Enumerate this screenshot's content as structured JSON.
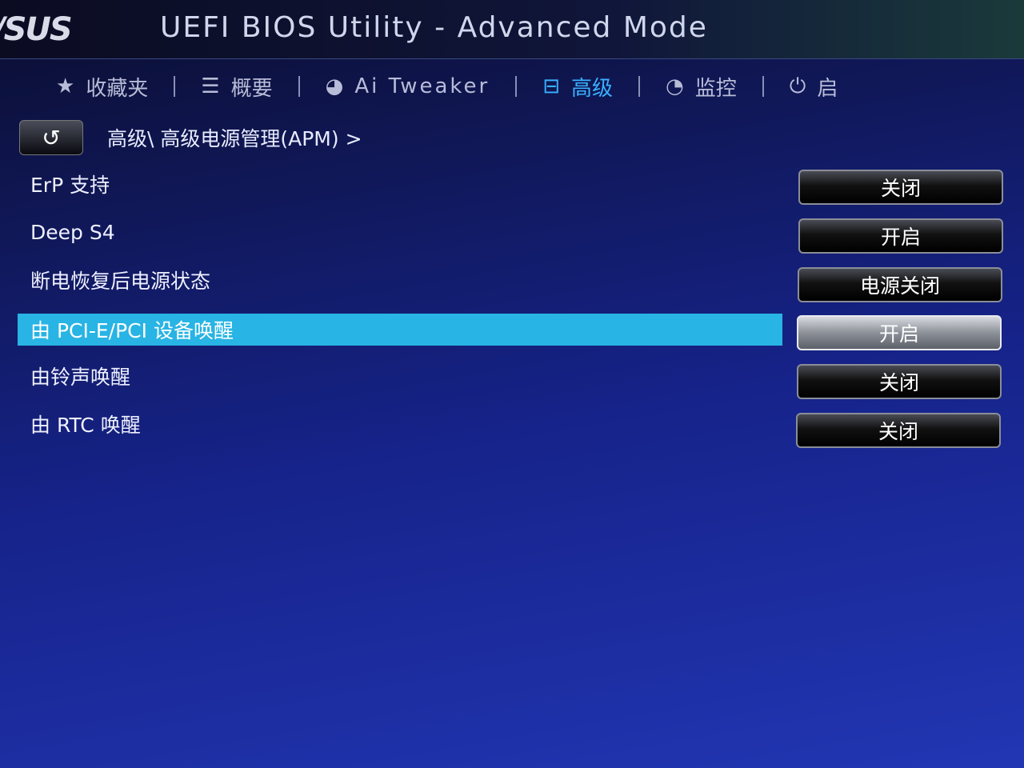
{
  "header": {
    "logo": "/SUS",
    "title": "UEFI BIOS Utility - Advanced Mode"
  },
  "tabs": [
    {
      "label": "收藏夹",
      "icon": "star-icon"
    },
    {
      "label": "概要",
      "icon": "list-icon"
    },
    {
      "label": "Ai Tweaker",
      "icon": "tweaker-icon"
    },
    {
      "label": "高级",
      "icon": "advanced-icon",
      "active": true
    },
    {
      "label": "监控",
      "icon": "monitor-icon"
    },
    {
      "label": "启",
      "icon": "power-icon"
    }
  ],
  "breadcrumb": {
    "back_icon": "back-arrow-icon",
    "path": "高级\\ 高级电源管理(APM) >"
  },
  "settings": [
    {
      "label": "ErP 支持",
      "value": "关闭"
    },
    {
      "label": "Deep S4",
      "value": "开启"
    },
    {
      "label": "断电恢复后电源状态",
      "value": "电源关闭"
    },
    {
      "label": "由 PCI-E/PCI 设备唤醒",
      "value": "开启",
      "selected": true
    },
    {
      "label": "由铃声唤醒",
      "value": "关闭"
    },
    {
      "label": "由 RTC 唤醒",
      "value": "关闭"
    }
  ],
  "colors": {
    "highlight": "#28b4e4",
    "active_tab": "#3ab0ff"
  }
}
